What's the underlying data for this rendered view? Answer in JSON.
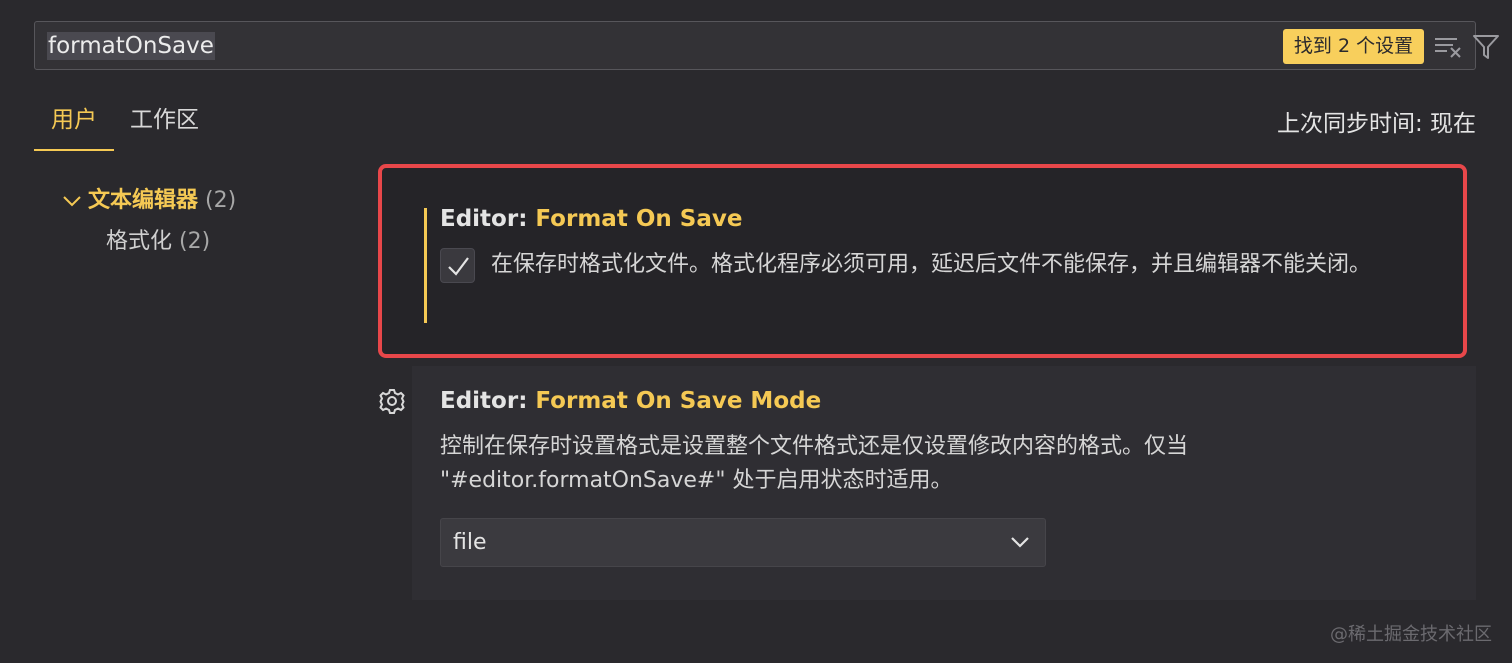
{
  "search": {
    "query": "formatOnSave",
    "result_badge": "找到 2 个设置"
  },
  "tabs": [
    {
      "label": "用户",
      "active": true
    },
    {
      "label": "工作区",
      "active": false
    }
  ],
  "sync_status": "上次同步时间: 现在",
  "toc": {
    "group": {
      "label": "文本编辑器",
      "count": "(2)"
    },
    "child": {
      "label": "格式化",
      "count": "(2)"
    }
  },
  "settings": [
    {
      "category": "Editor: ",
      "name": "Format On Save",
      "checked": true,
      "description": "在保存时格式化文件。格式化程序必须可用，延迟后文件不能保存，并且编辑器不能关闭。"
    },
    {
      "category": "Editor: ",
      "name": "Format On Save Mode",
      "description": "控制在保存时设置格式是设置整个文件格式还是仅设置修改内容的格式。仅当 \"#editor.formatOnSave#\" 处于启用状态时适用。",
      "selected_value": "file"
    }
  ],
  "watermark": "@稀土掘金技术社区",
  "colors": {
    "background": "#2a292d",
    "accent": "#f5c954",
    "highlight_border": "#e8474a"
  }
}
